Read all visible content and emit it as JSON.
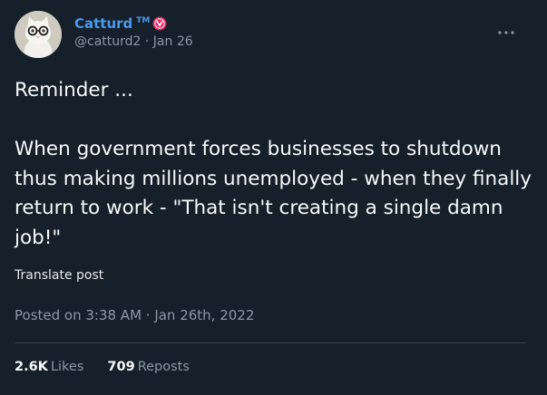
{
  "author": {
    "display_name": "Catturd",
    "tm": "TM",
    "handle_date": "@catturd2 · Jan 26",
    "badge_icon": "verified-red-badge",
    "avatar": "cat-with-glasses"
  },
  "post": {
    "line1": "Reminder ...",
    "line2": "When government forces businesses to shutdown thus making millions unemployed - when they finally return to work - \"That isn't creating a single damn job!\""
  },
  "translate_label": "Translate post",
  "timestamp": "Posted on 3:38 AM · Jan 26th, 2022",
  "stats": {
    "likes_count": "2.6K",
    "likes_label": "Likes",
    "reposts_count": "709",
    "reposts_label": "Reposts"
  },
  "colors": {
    "background": "#15202b",
    "accent": "#4a99e9",
    "muted": "#8b98a5",
    "badge": "#e0245e"
  }
}
